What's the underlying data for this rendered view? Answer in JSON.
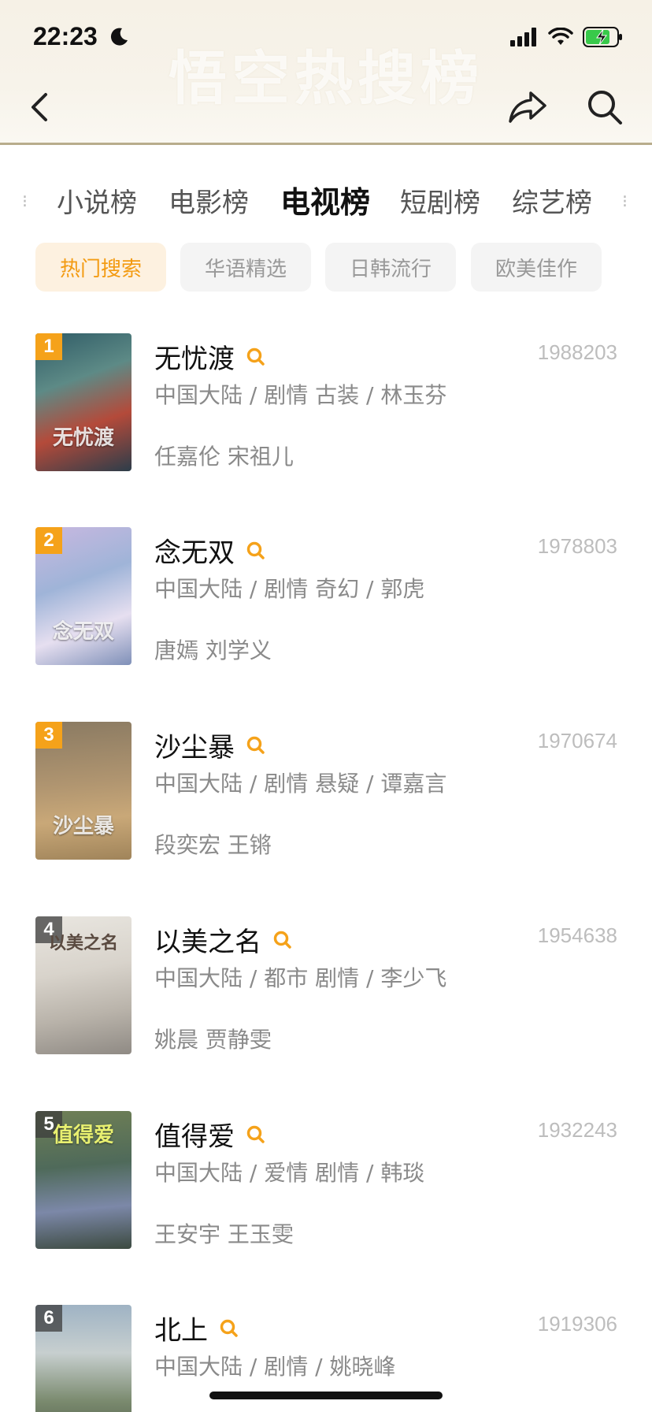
{
  "status_bar": {
    "time": "22:23"
  },
  "header": {
    "watermark": "悟空热搜榜"
  },
  "tabs": [
    {
      "label": "小说榜",
      "active": false
    },
    {
      "label": "电影榜",
      "active": false
    },
    {
      "label": "电视榜",
      "active": true
    },
    {
      "label": "短剧榜",
      "active": false
    },
    {
      "label": "综艺榜",
      "active": false
    }
  ],
  "chips": [
    {
      "label": "热门搜索",
      "active": true
    },
    {
      "label": "华语精选",
      "active": false
    },
    {
      "label": "日韩流行",
      "active": false
    },
    {
      "label": "欧美佳作",
      "active": false
    }
  ],
  "items": [
    {
      "rank": "1",
      "title": "无忧渡",
      "meta": "中国大陆 / 剧情 古装 / 林玉芬",
      "cast": "任嘉伦 宋祖儿",
      "score": "1988203",
      "poster_text": "无忧渡"
    },
    {
      "rank": "2",
      "title": "念无双",
      "meta": "中国大陆 / 剧情 奇幻 / 郭虎",
      "cast": "唐嫣 刘学义",
      "score": "1978803",
      "poster_text": "念无双"
    },
    {
      "rank": "3",
      "title": "沙尘暴",
      "meta": "中国大陆 / 剧情 悬疑 / 谭嘉言",
      "cast": "段奕宏 王锵",
      "score": "1970674",
      "poster_text": "沙尘暴"
    },
    {
      "rank": "4",
      "title": "以美之名",
      "meta": "中国大陆 / 都市 剧情 / 李少飞",
      "cast": "姚晨 贾静雯",
      "score": "1954638",
      "poster_text": "以美之名"
    },
    {
      "rank": "5",
      "title": "值得爱",
      "meta": "中国大陆 / 爱情 剧情 / 韩琰",
      "cast": "王安宇 王玉雯",
      "score": "1932243",
      "poster_text": "值得爱"
    },
    {
      "rank": "6",
      "title": "北上",
      "meta": "中国大陆 / 剧情 / 姚晓峰",
      "cast": "",
      "score": "1919306",
      "poster_text": ""
    }
  ],
  "colors": {
    "accent": "#f5a21a",
    "chip_active_bg": "#fdf1e0",
    "chip_active_text": "#f39b12"
  }
}
